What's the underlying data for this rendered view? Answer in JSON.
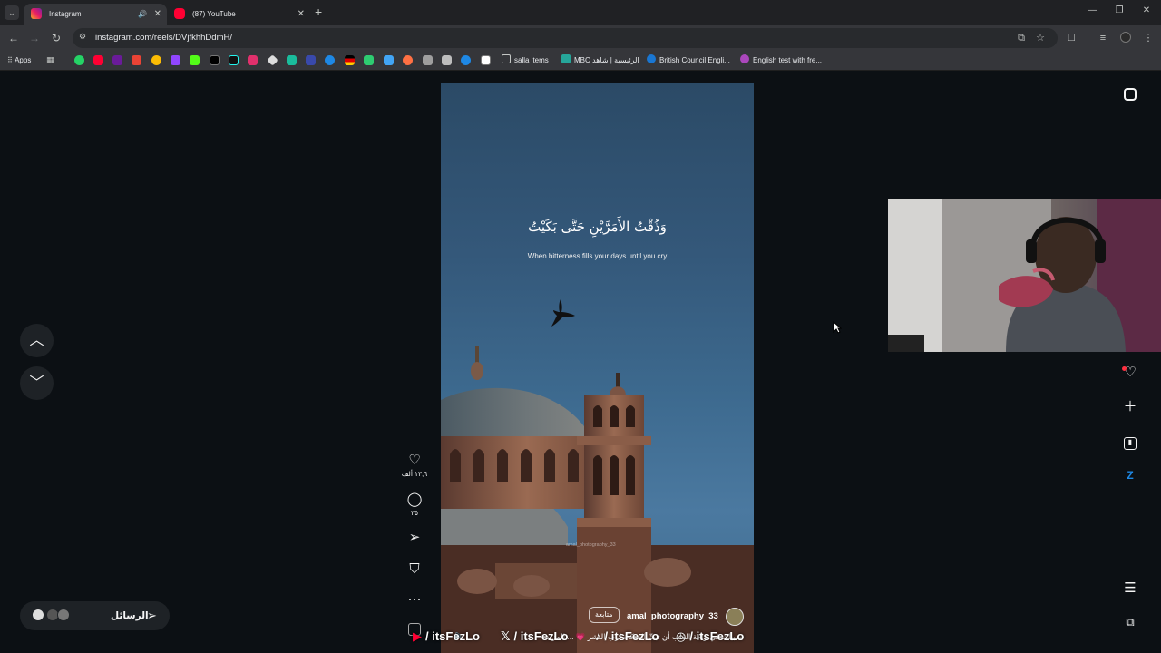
{
  "browser": {
    "tabs": [
      {
        "title": "Instagram",
        "active": true
      },
      {
        "title": "(87) YouTube",
        "active": false
      }
    ],
    "url": "instagram.com/reels/DVjfkhhDdmH/",
    "bookmarks": {
      "apps_label": "Apps",
      "items": [
        "salla items",
        "MBC الرئيسية | شاهد",
        "British Council Engli...",
        "English test with fre..."
      ]
    }
  },
  "reel": {
    "quote_ar": "وَذُقْتُ الأَمَرَّيْنِ حَتَّى بَكَيْتُ",
    "quote_en": "When bitterness fills your days until you cry",
    "watermark": "amal_photography_33",
    "author": "amal_photography_33",
    "follow_label": "متابعة",
    "caption": "سبيلك في راحة القلب أن تبثّ الشكاة لرب البشر 💗 ... المزيد",
    "likes": "١٣,٦ ألف",
    "comments": "٣٥"
  },
  "messages": {
    "label": "الرسائل"
  },
  "socials": [
    {
      "icon": "youtube-icon",
      "handle": "/ itsFezLo"
    },
    {
      "icon": "x-icon",
      "handle": "/ itsFezLo"
    },
    {
      "icon": "tiktok-icon",
      "handle": "/ itsFezLo"
    },
    {
      "icon": "instagram-icon",
      "handle": "/ itsFezLo"
    }
  ],
  "colors": {
    "chrome_dark": "#202124",
    "chrome_toolbar": "#35363a",
    "page_bg": "#0c1014",
    "notification": "#ff3040"
  }
}
